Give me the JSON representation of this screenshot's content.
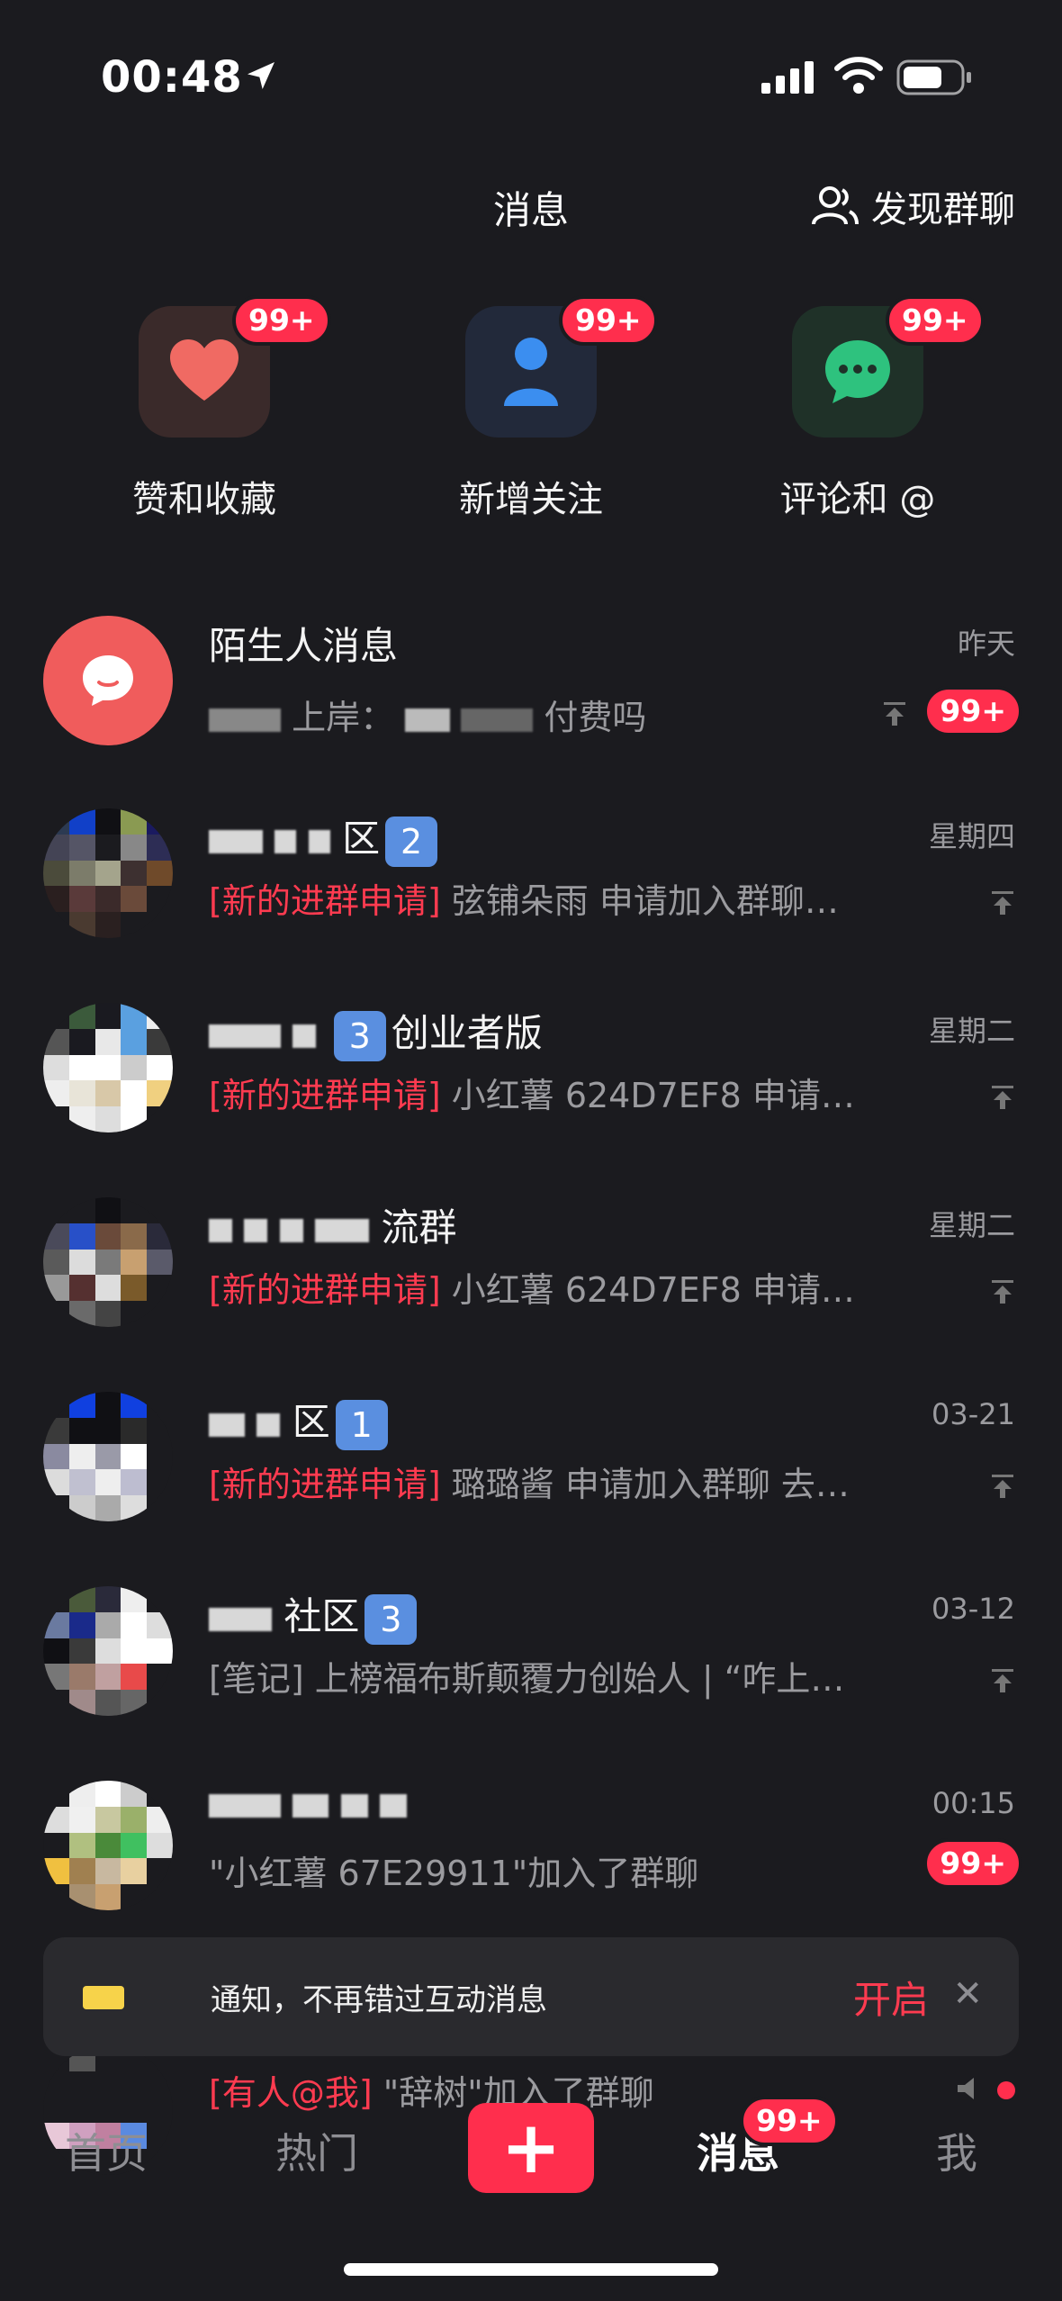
{
  "status_bar": {
    "time": "00:48"
  },
  "header": {
    "title": "消息",
    "discover": "发现群聊"
  },
  "shortcuts": [
    {
      "label": "赞和收藏",
      "badge": "99+",
      "icon": "heart-icon",
      "color": "#f06a63",
      "tile": "#3a2a2a"
    },
    {
      "label": "新增关注",
      "badge": "99+",
      "icon": "person-icon",
      "color": "#3b8ef0",
      "tile": "#22293a"
    },
    {
      "label": "评论和 @",
      "badge": "99+",
      "icon": "chat-bubble-icon",
      "color": "#2ec27e",
      "tile": "#1f3128"
    }
  ],
  "stranger": {
    "title": "陌生人消息",
    "preview_a": "上岸：",
    "preview_b": "付费吗",
    "time": "昨天",
    "badge": "99+"
  },
  "threads": [
    {
      "title_suffix": "区",
      "num": "2",
      "tag": "[新的进群申请]",
      "preview": " 弦铺朵雨 申请加入群聊…",
      "time": "星期四"
    },
    {
      "title_suffix": "创业者版",
      "num": "3",
      "tag": "[新的进群申请]",
      "preview": " 小红薯 624D7EF8 申请…",
      "time": "星期二"
    },
    {
      "title_suffix": "流群",
      "num": "",
      "tag": "[新的进群申请]",
      "preview": " 小红薯 624D7EF8 申请…",
      "time": "星期二"
    },
    {
      "title_suffix": "区",
      "num": "1",
      "tag": "[新的进群申请]",
      "preview": " 璐璐酱 申请加入群聊 去…",
      "time": "03-21"
    },
    {
      "title_suffix": "社区",
      "num": "3",
      "tag": "[笔记]",
      "preview": " 上榜福布斯颠覆力创始人 | “咋上…",
      "time": "03-12"
    },
    {
      "title_suffix": "",
      "num": "",
      "tag": "",
      "preview": "\"小红薯 67E29911\"加入了群聊",
      "time": "00:15",
      "badge": "99+"
    }
  ],
  "last_row": {
    "tag": "[有人@我]",
    "preview": " \"辞树\"加入了群聊"
  },
  "notification": {
    "text": "通知，不再错过互动消息",
    "action": "开启",
    "close": "✕"
  },
  "tabbar": {
    "home": "首页",
    "hot": "热门",
    "plus": "+",
    "messages": "消息",
    "messages_badge": "99+",
    "me": "我"
  },
  "colors": {
    "accent": "#ff2e4d",
    "background": "#1b1b1f"
  }
}
